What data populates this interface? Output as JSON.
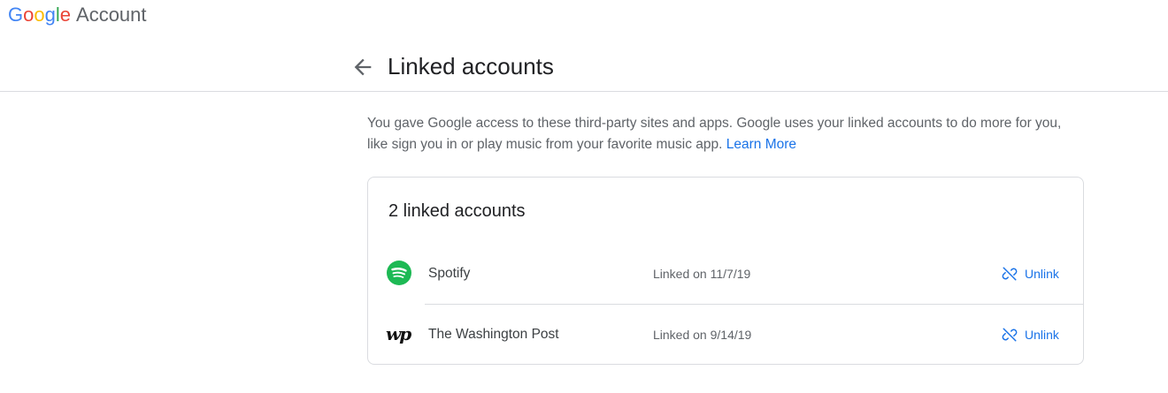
{
  "brand": {
    "logo_letters": [
      "G",
      "o",
      "o",
      "g",
      "l",
      "e"
    ],
    "product": "Account"
  },
  "header": {
    "title": "Linked accounts",
    "back_icon": "arrow-left-icon"
  },
  "description": {
    "text": "You gave Google access to these third-party sites and apps. Google uses your linked accounts to do more for you, like sign you in or play music from your favorite music app.",
    "link_text": "Learn More"
  },
  "card": {
    "title": "2 linked accounts",
    "accounts": [
      {
        "name": "Spotify",
        "linked_on": "Linked on 11/7/19",
        "action": "Unlink",
        "logo": "spotify-logo",
        "logo_color": "#1db954"
      },
      {
        "name": "The Washington Post",
        "linked_on": "Linked on 9/14/19",
        "action": "Unlink",
        "logo": "washington-post-logo",
        "logo_text": "wp"
      }
    ]
  },
  "colors": {
    "accent": "#1a73e8",
    "border": "#dadce0",
    "text_secondary": "#5f6368"
  }
}
